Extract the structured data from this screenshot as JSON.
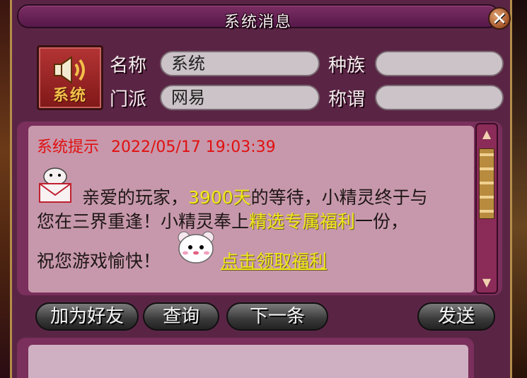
{
  "window": {
    "title": "系统消息"
  },
  "sender": {
    "avatar_label": "系统",
    "name_label": "名称",
    "name_value": "系统",
    "race_label": "种族",
    "race_value": "",
    "faction_label": "门派",
    "faction_value": "网易",
    "title_label": "称谓",
    "title_value": ""
  },
  "message": {
    "header_label": "系统提示",
    "timestamp": "2022/05/17 19:03:39",
    "line1_prefix": "亲爱的玩家，",
    "line1_days": "3900天",
    "line1_suffix": "的等待，小精灵终于与",
    "line2_prefix": "您在三界重逢！小精灵奉上",
    "line2_highlight": "精选专属福利",
    "line2_suffix": "一份，",
    "line3": "祝您游戏愉快！",
    "link": "点击领取福利"
  },
  "buttons": {
    "add_friend": "加为好友",
    "query": "查询",
    "next": "下一条",
    "send": "发送"
  },
  "colors": {
    "header_red": "#e01010",
    "highlight_yellow": "#f0e81a",
    "panel_purple": "#7a2f5c",
    "message_bg": "#c798ab"
  }
}
